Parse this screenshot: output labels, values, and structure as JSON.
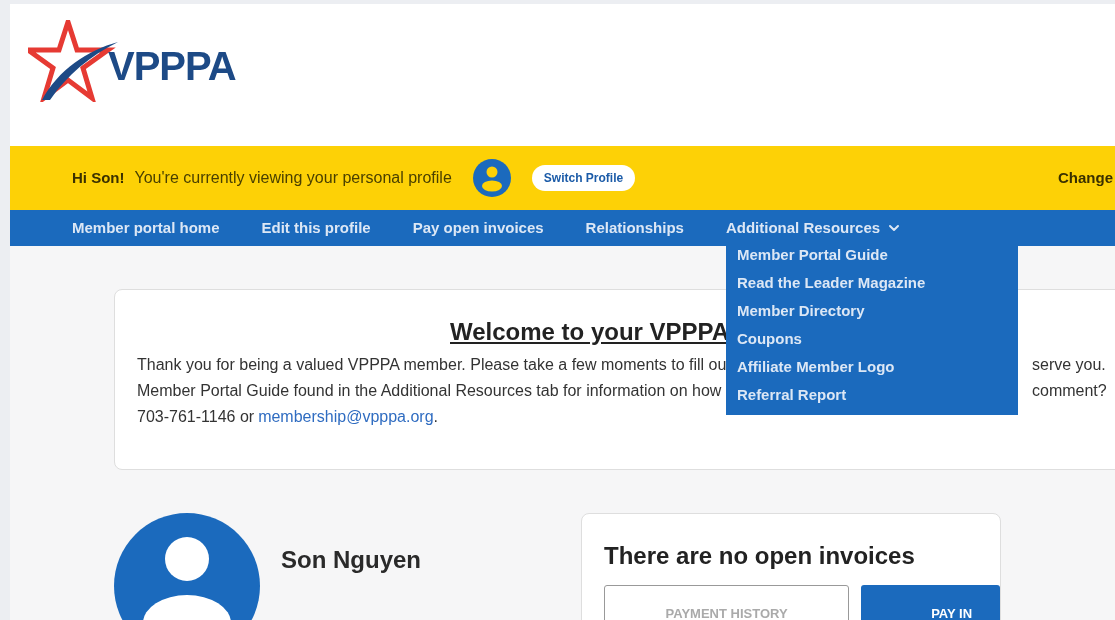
{
  "logo": {
    "text": "VPPPA"
  },
  "profile_bar": {
    "greeting": "Hi Son!",
    "message": "You're currently viewing your personal profile",
    "switch_button": "Switch Profile",
    "right_link": "Change"
  },
  "nav": {
    "items": [
      {
        "label": "Member portal home",
        "kind": "link"
      },
      {
        "label": "Edit this profile",
        "kind": "link"
      },
      {
        "label": "Pay open invoices",
        "kind": "link"
      },
      {
        "label": "Relationships",
        "kind": "link"
      },
      {
        "label": "Additional Resources",
        "kind": "dropdown",
        "expanded": true
      }
    ],
    "dropdown_items": [
      "Member Portal Guide",
      "Read the Leader Magazine",
      "Member Directory",
      "Coupons",
      "Affiliate Member Logo",
      "Referral Report"
    ]
  },
  "welcome": {
    "title": "Welcome to your VPPPA",
    "lines": [
      {
        "left": "Thank you for being a valued VPPPA member. Please take a few moments to fill ou",
        "right": "serve you."
      },
      {
        "left": "Member Portal Guide found in the Additional Resources tab for information on how",
        "right": "comment?"
      }
    ],
    "contact": {
      "before": "703-761-1146 or",
      "email": "membership@vpppa.org",
      "after": "."
    }
  },
  "profile": {
    "name": "Son Nguyen"
  },
  "invoices": {
    "title": "There are no open invoices",
    "buttons": [
      {
        "label": "PAYMENT HISTORY",
        "kind": "outline"
      },
      {
        "label": "PAY IN",
        "kind": "primary"
      }
    ]
  }
}
